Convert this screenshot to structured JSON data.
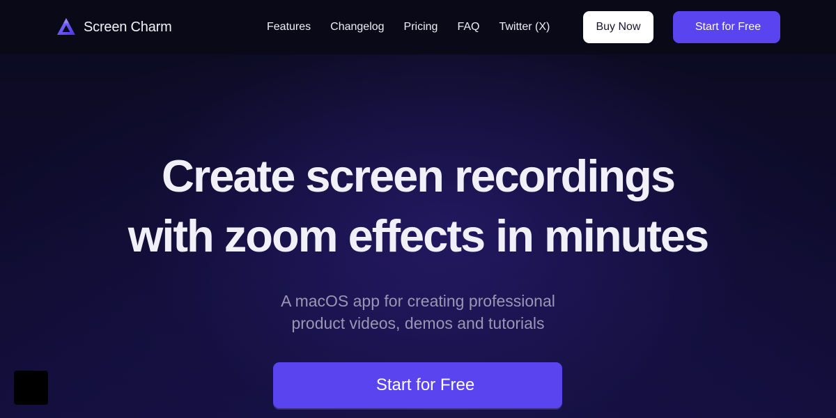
{
  "brand": {
    "name": "Screen Charm",
    "logo_icon": "triangle-logo-icon"
  },
  "nav": {
    "links": [
      {
        "label": "Features"
      },
      {
        "label": "Changelog"
      },
      {
        "label": "Pricing"
      },
      {
        "label": "FAQ"
      },
      {
        "label": "Twitter (X)"
      }
    ],
    "buy_label": "Buy Now",
    "start_label": "Start for Free"
  },
  "hero": {
    "title_line1": "Create screen recordings",
    "title_line2": "with zoom effects in minutes",
    "subtitle_line1": "A macOS app for creating professional",
    "subtitle_line2": "product videos, demos and tutorials",
    "cta_label": "Start for Free"
  },
  "colors": {
    "accent": "#5a44f0",
    "background": "#0b0a1c",
    "nav_background": "#0a0918",
    "heading": "#f1eff8",
    "subtitle": "#9a97b2"
  }
}
